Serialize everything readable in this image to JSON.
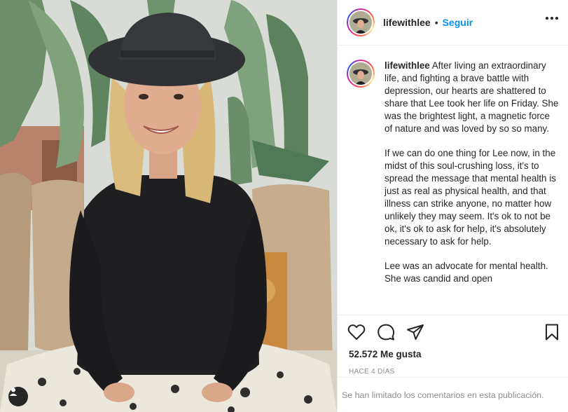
{
  "post": {
    "username": "lifewithlee",
    "separator": "•",
    "follow_label": "Seguir",
    "caption_username": "lifewithlee",
    "caption_paragraphs": [
      "After living an extraordinary life, and fighting a brave battle with depression, our hearts are shattered to share that Lee took her life on Friday. She was the brightest light, a magnetic force of nature and was loved by so so many.",
      "If we can do one thing for Lee now, in the midst of this soul-crushing loss, it's to spread the message that mental health is just as real as physical health, and that illness can strike anyone, no matter how unlikely they may seem. It's ok to not be ok, it's ok to ask for help, it's absolutely necessary to ask for help.",
      "Lee was an advocate for mental health. She was candid and open"
    ],
    "likes": "52.572 Me gusta",
    "timestamp": "HACE 4 DÍAS",
    "comments_disabled": "Se han limitado los comentarios en esta publicación."
  },
  "icons": {
    "like": "heart-icon",
    "comment": "comment-icon",
    "share": "share-icon",
    "save": "bookmark-icon",
    "more": "more-options-icon",
    "tagged": "user-tag-icon"
  },
  "colors": {
    "accent": "#0095f6",
    "text": "#262626",
    "muted": "#8e8e8e"
  }
}
